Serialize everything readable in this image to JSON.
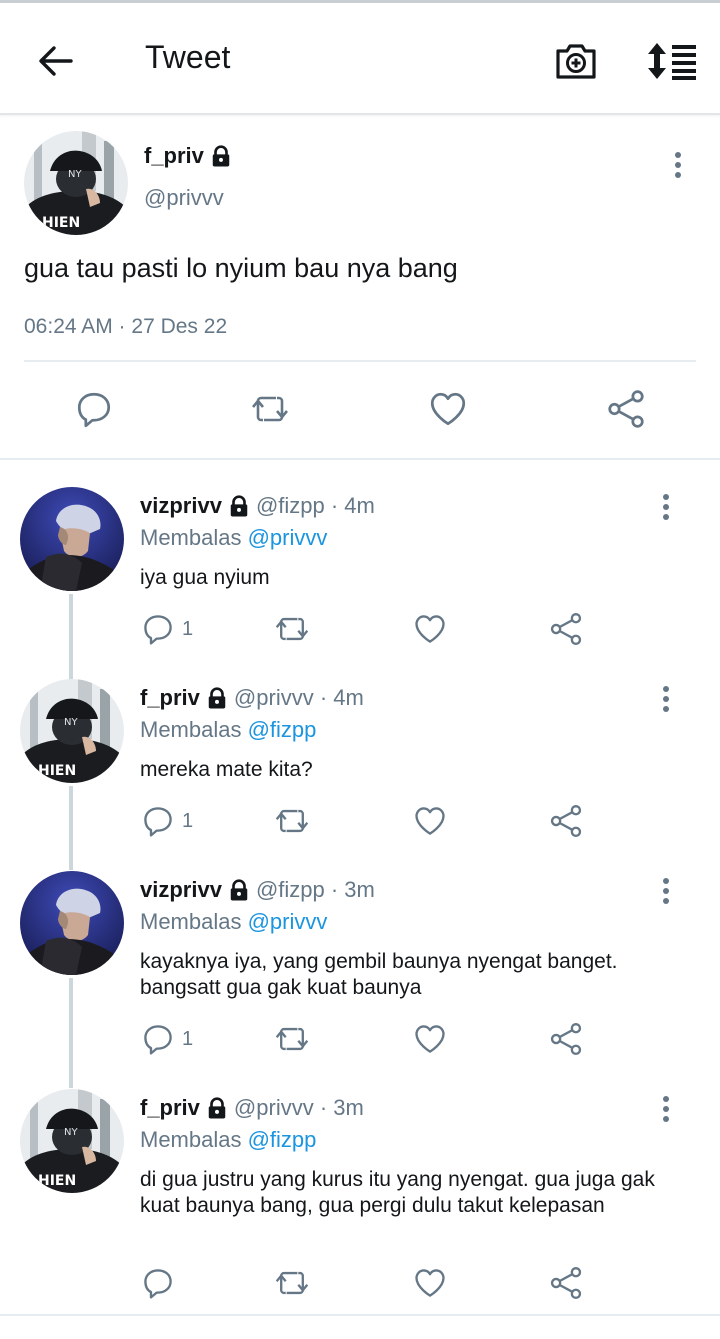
{
  "header": {
    "title": "Tweet",
    "back_icon": "back-arrow-icon",
    "camera_icon": "camera-plus-icon",
    "sort_icon": "sort-order-icon"
  },
  "main_tweet": {
    "name": "f_priv",
    "handle": "@privvv",
    "text": "gua tau pasti lo nyium bau nya bang",
    "timestamp": "06:24 AM · 27 Des 22",
    "actions": [
      "reply-icon",
      "retweet-icon",
      "like-icon",
      "share-icon"
    ]
  },
  "replies": [
    {
      "name": "vizprivv",
      "meta": "@fizpp · 4m",
      "replying_prefix": "Membalas ",
      "replying_to": "@privvv",
      "text": "iya gua nyium",
      "reply_count": "1"
    },
    {
      "name": "f_priv",
      "meta": "@privvv · 4m",
      "replying_prefix": "Membalas ",
      "replying_to": "@fizpp",
      "text": "mereka mate kita?",
      "reply_count": "1"
    },
    {
      "name": "vizprivv",
      "meta": "@fizpp · 3m",
      "replying_prefix": "Membalas ",
      "replying_to": "@privvv",
      "text": "kayaknya iya, yang gembil baunya nyengat banget. bangsatt gua gak kuat baunya",
      "reply_count": "1"
    },
    {
      "name": "f_priv",
      "meta": "@privvv · 3m",
      "replying_prefix": "Membalas ",
      "replying_to": "@fizpp",
      "text": "di gua justru yang kurus itu yang nyengat. gua juga gak kuat baunya bang, gua pergi dulu takut kelepasan",
      "reply_count": ""
    }
  ],
  "colors": {
    "text": "#14171a",
    "secondary": "#657786",
    "mention": "#1b95e0",
    "divider": "#e6ecf0"
  }
}
